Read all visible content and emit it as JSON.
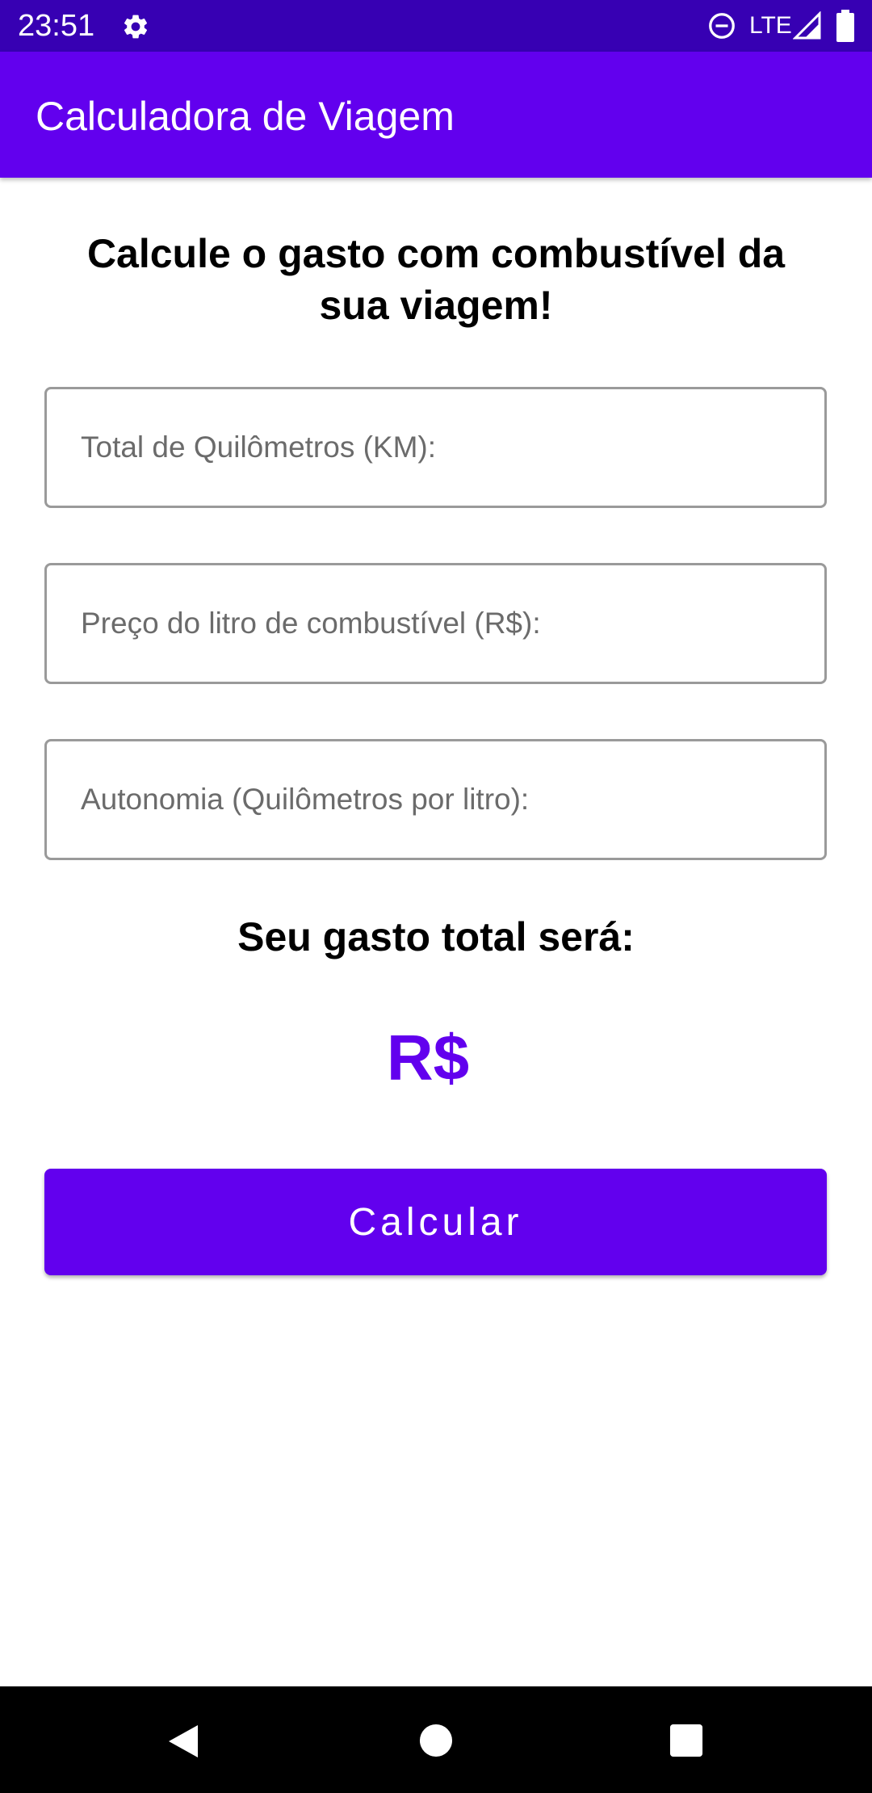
{
  "status_bar": {
    "time": "23:51",
    "network": "LTE",
    "icons": [
      "gear-icon",
      "do-not-disturb-icon",
      "signal-icon",
      "battery-icon"
    ]
  },
  "app_bar": {
    "title": "Calculadora de Viagem"
  },
  "main": {
    "heading": "Calcule o gasto com combustível da sua viagem!",
    "fields": {
      "km": {
        "placeholder": "Total de Quilômetros (KM):",
        "value": ""
      },
      "price": {
        "placeholder": "Preço do litro de combustível (R$):",
        "value": ""
      },
      "autonomy": {
        "placeholder": "Autonomia (Quilômetros por litro):",
        "value": ""
      }
    },
    "result_label": "Seu gasto total será:",
    "result_value": "R$",
    "calculate_button": "Calcular"
  },
  "nav_bar": {
    "icons": [
      "back-icon",
      "home-icon",
      "recents-icon"
    ]
  },
  "colors": {
    "status_bar": "#3700b3",
    "primary": "#6200ee",
    "field_border": "#9a9a9a",
    "background": "#ffffff",
    "nav_bar": "#000000"
  }
}
